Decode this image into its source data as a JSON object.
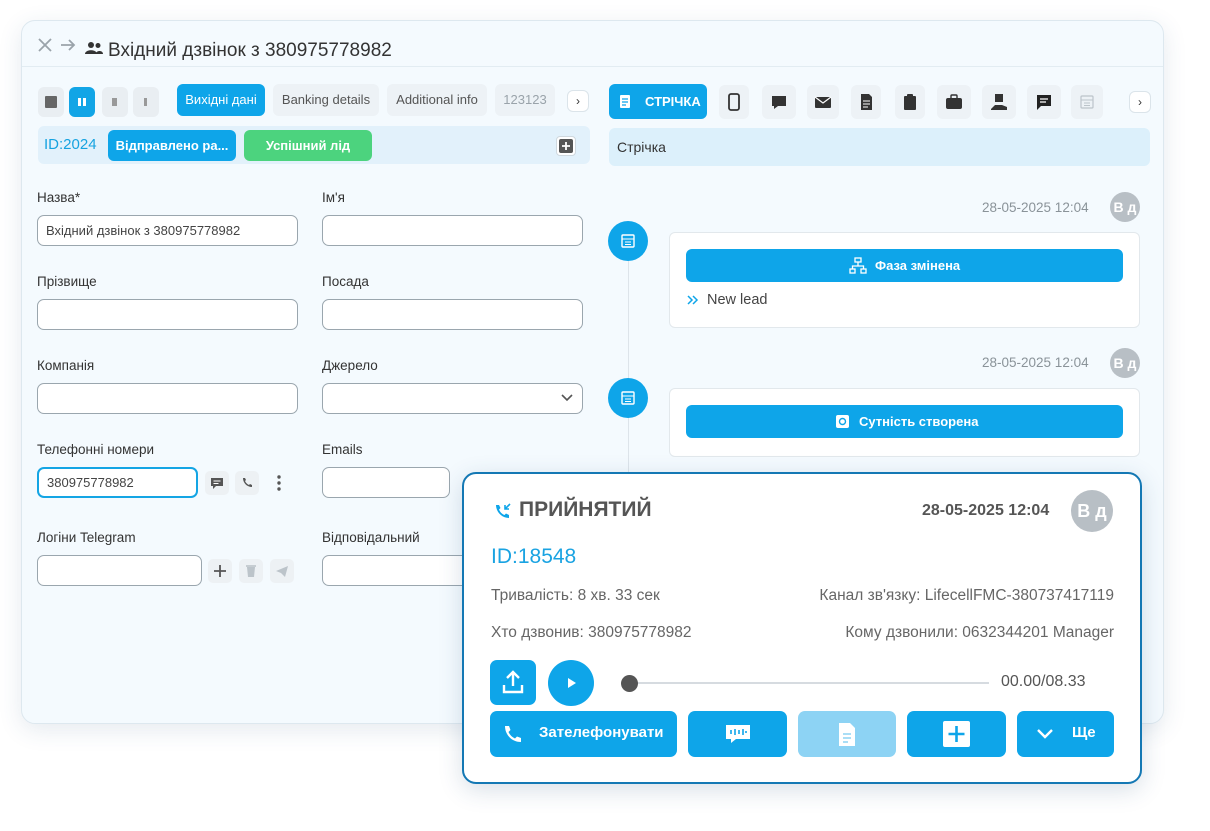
{
  "window": {
    "title": "Вхідний дзвінок з 380975778982"
  },
  "left_tabs": [
    {
      "label": "Вихідні дані",
      "active": true
    },
    {
      "label": "Banking details",
      "active": false
    },
    {
      "label": "Additional info",
      "active": false
    },
    {
      "label": "123123",
      "active": false
    }
  ],
  "status_bar": {
    "id_label": "ID:2024",
    "chip_sent": "Відправлено ра...",
    "chip_success": "Успішний лід"
  },
  "form": {
    "name_label": "Назва*",
    "name_value": "Вхідний дзвінок з 380975778982",
    "first_name_label": "Ім'я",
    "last_name_label": "Прізвище",
    "position_label": "Посада",
    "company_label": "Компанія",
    "source_label": "Джерело",
    "phones_label": "Телефонні номери",
    "phone_value": "380975778982",
    "emails_label": "Emails",
    "telegram_label": "Логіни Telegram",
    "responsible_label": "Відповідальний"
  },
  "right_panel": {
    "feed_tab_label": "СТРІЧКА",
    "feed_bar_label": "Стрічка",
    "events": [
      {
        "timestamp": "28-05-2025 12:04",
        "avatar": "В д",
        "button": "Фаза змінена",
        "detail": "New lead"
      },
      {
        "timestamp": "28-05-2025 12:04",
        "avatar": "В д",
        "button": "Сутність створена"
      }
    ]
  },
  "call_popup": {
    "status": "ПРИЙНЯТИЙ",
    "timestamp": "28-05-2025 12:04",
    "avatar": "В д",
    "id_label": "ID:18548",
    "duration": "Тривалість: 8 хв. 33 сек",
    "channel": "Канал зв'язку: LifecellFMC-380737417119",
    "caller": "Хто дзвонив: 380975778982",
    "callee": "Кому дзвонили: 0632344201 Manager",
    "time_display": "00.00/08.33",
    "progress": 0,
    "call_button": "Зателефонувати",
    "more_button": "Ще"
  },
  "colors": {
    "accent": "#0ea5e9",
    "success": "#4cd37e",
    "popup_border": "#1478b4"
  }
}
